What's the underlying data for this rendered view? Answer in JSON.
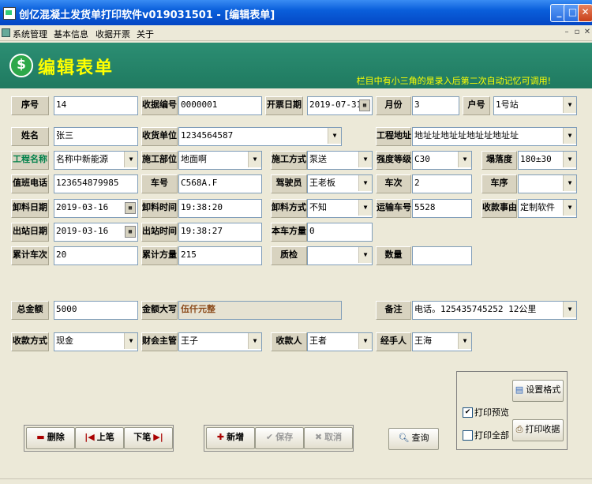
{
  "window": {
    "title": "创亿混凝土发货单打印软件v019031501 - [编辑表单]"
  },
  "menu": [
    "系统管理",
    "基本信息",
    "收据开票",
    "关于"
  ],
  "header": {
    "title": "编辑表单",
    "hint": "栏目中有小三角的是录入后第二次自动记忆可调用!"
  },
  "form": {
    "serial_no": {
      "label": "序号",
      "value": "14"
    },
    "receipt_no": {
      "label": "收据编号",
      "value": "0000001"
    },
    "invoice_date": {
      "label": "开票日期",
      "value": "2019-07-31"
    },
    "month": {
      "label": "月份",
      "value": "3"
    },
    "account": {
      "label": "户号",
      "value": "1号站"
    },
    "name": {
      "label": "姓名",
      "value": "张三"
    },
    "receiver": {
      "label": "收货单位",
      "value": "1234564587"
    },
    "project_address": {
      "label": "工程地址",
      "value": "地址址地址址地址址地址址"
    },
    "project_name": {
      "label": "工程名称",
      "value": "名称中新能源"
    },
    "construction_part": {
      "label": "施工部位",
      "value": "地面啊"
    },
    "construction_method": {
      "label": "施工方式",
      "value": "泵送"
    },
    "strength_grade": {
      "label": "强度等级",
      "value": "C30"
    },
    "slump": {
      "label": "塌落度",
      "value": "180±30"
    },
    "duty_phone": {
      "label": "值班电话",
      "value": "123654879985"
    },
    "car_no": {
      "label": "车号",
      "value": "C568A.F"
    },
    "driver": {
      "label": "驾驶员",
      "value": "王老板"
    },
    "trip_no": {
      "label": "车次",
      "value": "2"
    },
    "car_seq": {
      "label": "车序",
      "value": ""
    },
    "unload_date": {
      "label": "卸料日期",
      "value": "2019-03-16"
    },
    "unload_time": {
      "label": "卸料时间",
      "value": "19:38:20"
    },
    "unload_method": {
      "label": "卸料方式",
      "value": "不知"
    },
    "transport_car": {
      "label": "运输车号",
      "value": "5528"
    },
    "charge_reason": {
      "label": "收款事由",
      "value": "定制软件"
    },
    "depart_date": {
      "label": "出站日期",
      "value": "2019-03-16"
    },
    "depart_time": {
      "label": "出站时间",
      "value": "19:38:27"
    },
    "car_volume": {
      "label": "本车方量",
      "value": "0"
    },
    "total_trips": {
      "label": "累计车次",
      "value": "20"
    },
    "total_volume": {
      "label": "累计方量",
      "value": "215"
    },
    "quality_check": {
      "label": "质检",
      "value": ""
    },
    "quantity": {
      "label": "数量",
      "value": ""
    },
    "total_amount": {
      "label": "总金额",
      "value": "5000"
    },
    "amount_upper": {
      "label": "金额大写",
      "value": "伍仟元整"
    },
    "remark": {
      "label": "备注",
      "value": "电话。125435745252 12公里"
    },
    "payment_method": {
      "label": "收款方式",
      "value": "现金"
    },
    "finance_manager": {
      "label": "财会主管",
      "value": "王子"
    },
    "payee": {
      "label": "收款人",
      "value": "王者"
    },
    "handler": {
      "label": "经手人",
      "value": "王海"
    }
  },
  "buttons": {
    "delete": "删除",
    "prev": "上笔",
    "next": "下笔",
    "add": "新增",
    "save": "保存",
    "cancel": "取消",
    "query": "查询",
    "print_format": "设置格式",
    "print_receipt": "打印收据"
  },
  "print_options": {
    "preview": {
      "label": "打印预览",
      "checked": true
    },
    "print_all": {
      "label": "打印全部",
      "checked": false
    }
  }
}
